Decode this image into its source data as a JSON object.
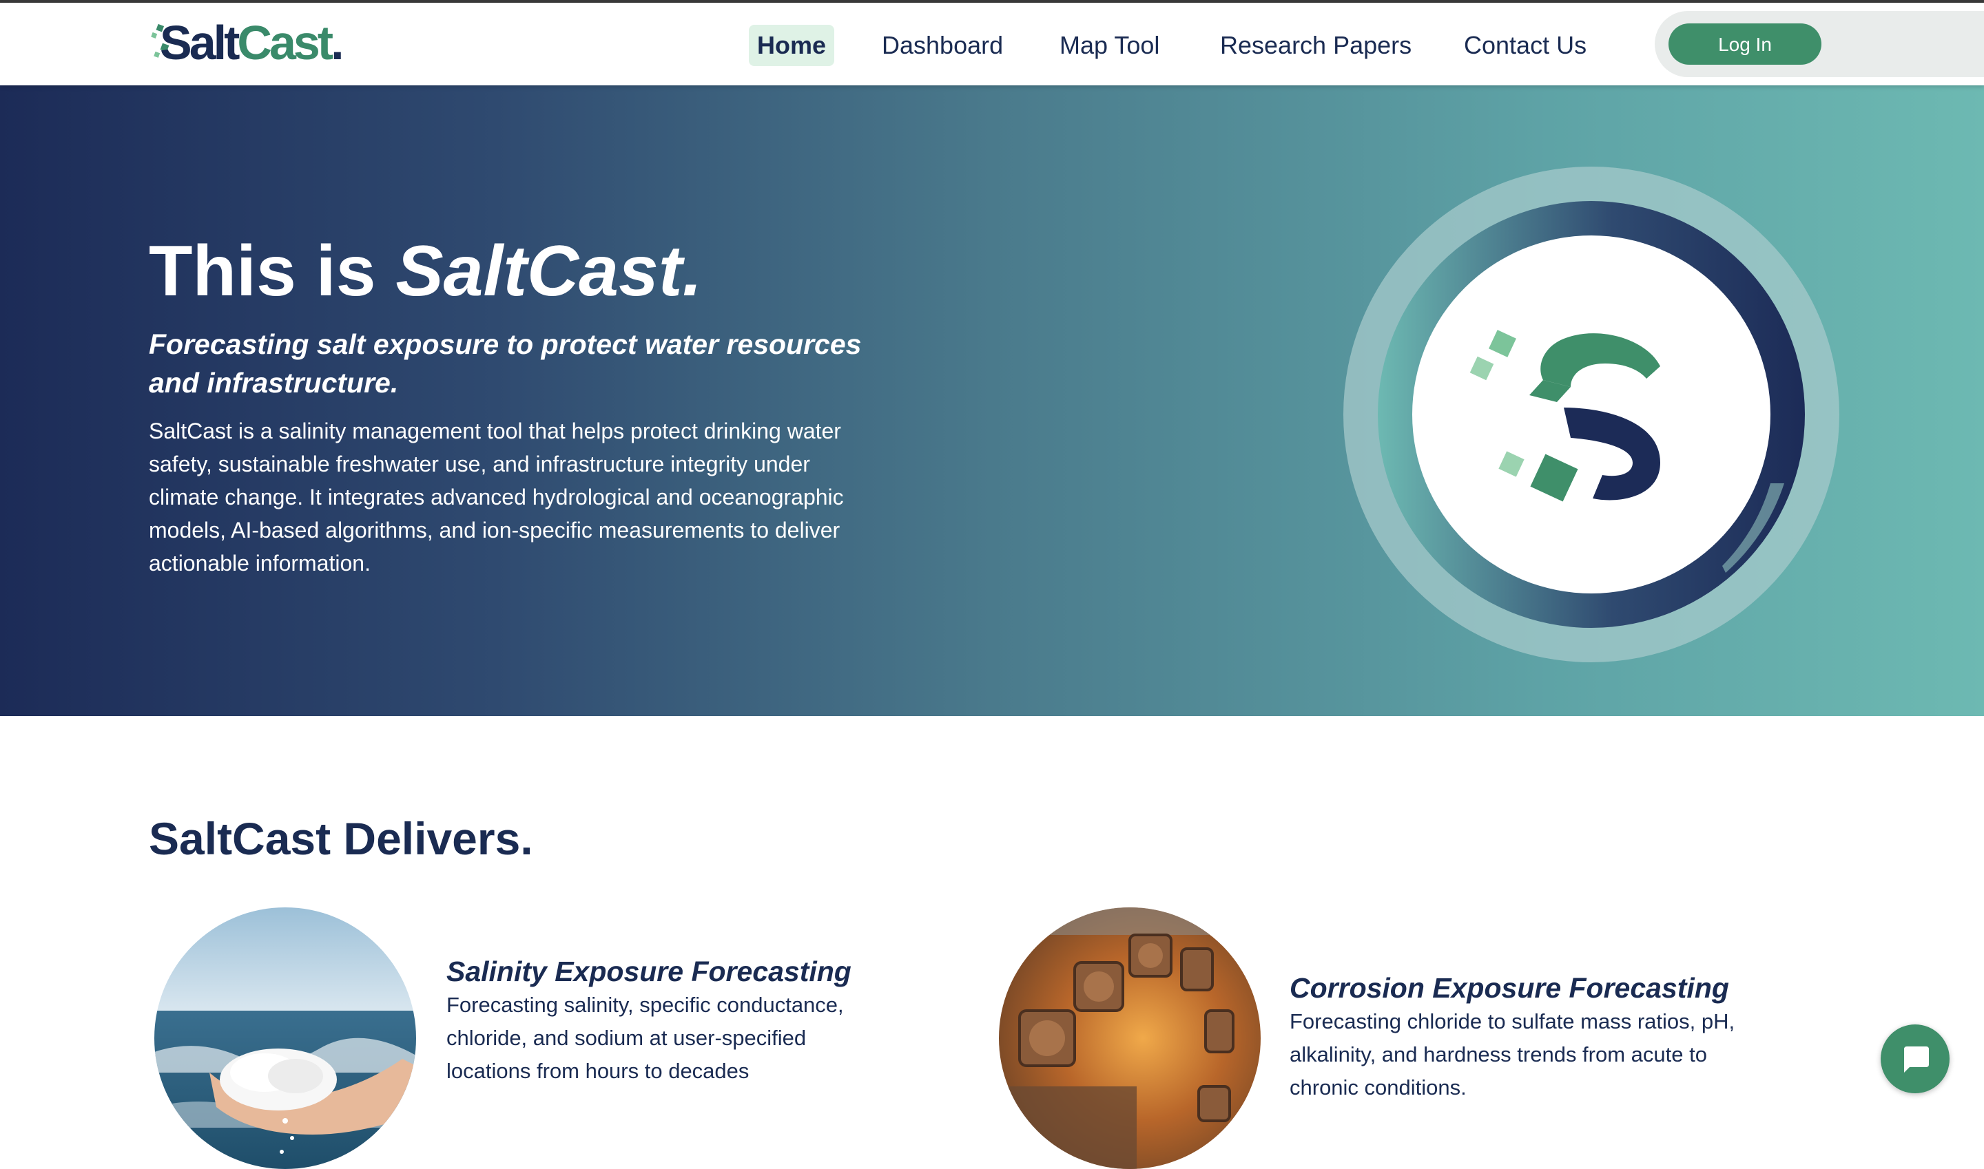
{
  "nav": {
    "logo_alt": "SaltCast.",
    "logo_salt": "Salt",
    "logo_cast": "Cast",
    "logo_dot": ".",
    "links": [
      {
        "label": "Home",
        "active": true
      },
      {
        "label": "Dashboard",
        "active": false
      },
      {
        "label": "Map Tool",
        "active": false
      },
      {
        "label": "Research Papers",
        "active": false
      },
      {
        "label": "Contact Us",
        "active": false
      }
    ],
    "login_label": "Log In"
  },
  "hero": {
    "title_prefix": "This is ",
    "title_brand": "SaltCast.",
    "subtitle": "Forecasting salt exposure to protect water resources and infrastructure.",
    "description": "SaltCast is a salinity management tool that helps protect drinking water safety, sustainable freshwater use, and infrastructure integrity under climate change. It integrates advanced hydrological and oceanographic models, AI-based algorithms, and ion-specific measurements to deliver actionable information."
  },
  "delivers": {
    "title": "SaltCast Delivers.",
    "features": [
      {
        "title": "Salinity Exposure Forecasting",
        "description": "Forecasting salinity, specific conductance, chloride, and sodium at user-specified locations from hours to decades",
        "image_icon": "hand-holding-salt-photo"
      },
      {
        "title": "Corrosion Exposure Forecasting",
        "description": "Forecasting chloride to sulfate mass ratios, pH, alkalinity, and hardness trends from acute to chronic conditions.",
        "image_icon": "rusty-bolts-photo"
      }
    ]
  },
  "colors": {
    "navy": "#1a2b52",
    "green": "#3f8f6a",
    "teal": "#6db9b2",
    "active_nav_bg": "#dff2e6"
  },
  "chat": {
    "icon": "chat-bubble-icon"
  }
}
